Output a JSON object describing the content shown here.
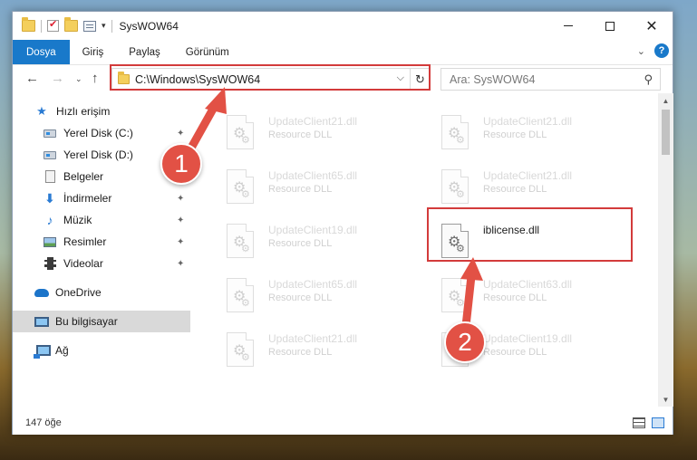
{
  "window": {
    "title": "SysWOW64",
    "controls": {
      "minimize": "minimize",
      "maximize": "maximize",
      "close": "✕"
    }
  },
  "ribbon": {
    "tabs": [
      "Dosya",
      "Giriş",
      "Paylaş",
      "Görünüm"
    ],
    "help": "?"
  },
  "address_bar": {
    "path": "C:\\Windows\\SysWOW64",
    "refresh": "↻",
    "dropdown": "⌵"
  },
  "search": {
    "placeholder": "Ara: SysWOW64",
    "icon": "⚲"
  },
  "sidebar": {
    "items": [
      {
        "label": "Hızlı erişim",
        "icon": "star-icon"
      },
      {
        "label": "Yerel Disk (C:)",
        "icon": "drive-icon",
        "pinned": true
      },
      {
        "label": "Yerel Disk (D:)",
        "icon": "drive-icon"
      },
      {
        "label": "Belgeler",
        "icon": "document-icon"
      },
      {
        "label": "İndirmeler",
        "icon": "download-icon",
        "pinned": true
      },
      {
        "label": "Müzik",
        "icon": "music-icon",
        "pinned": true
      },
      {
        "label": "Resimler",
        "icon": "picture-icon",
        "pinned": true
      },
      {
        "label": "Videolar",
        "icon": "video-icon",
        "pinned": true
      },
      {
        "label": "OneDrive",
        "icon": "cloud-icon"
      },
      {
        "label": "Bu bilgisayar",
        "icon": "computer-icon",
        "selected": true
      },
      {
        "label": "Ağ",
        "icon": "network-icon"
      }
    ],
    "pin_glyph": "📌"
  },
  "files": [
    {
      "name": "UpdateClient21.dll",
      "type": "Resource DLL",
      "faded": true
    },
    {
      "name": "UpdateClient21.dll",
      "type": "Resource DLL",
      "faded": true
    },
    {
      "name": "UpdateClient65.dll",
      "type": "Resource DLL",
      "faded": true
    },
    {
      "name": "UpdateClient21.dll",
      "type": "Resource DLL",
      "faded": true
    },
    {
      "name": "UpdateClient19.dll",
      "type": "Resource DLL",
      "faded": true
    },
    {
      "name": "iblicense.dll",
      "type": "",
      "faded": false
    },
    {
      "name": "UpdateClient65.dll",
      "type": "Resource DLL",
      "faded": true
    },
    {
      "name": "UpdateClient63.dll",
      "type": "Resource DLL",
      "faded": true
    },
    {
      "name": "UpdateClient21.dll",
      "type": "Resource DLL",
      "faded": true
    },
    {
      "name": "UpdateClient19.dll",
      "type": "Resource DLL",
      "faded": true
    }
  ],
  "status": {
    "item_count": "147 öğe"
  },
  "annotations": {
    "step1": "1",
    "step2": "2",
    "color": "#d33b3b"
  }
}
